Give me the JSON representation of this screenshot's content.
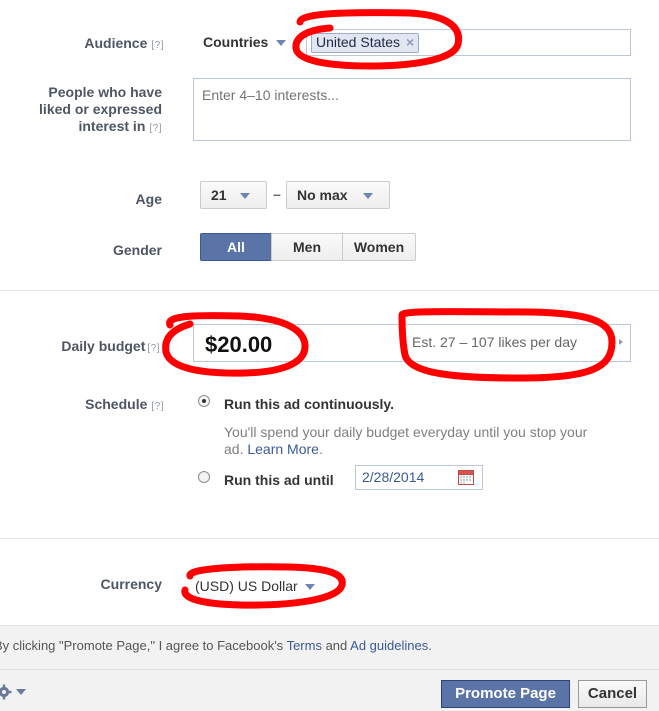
{
  "targeting": {
    "audience_label": "Audience",
    "help": "[?]",
    "location_type": "Countries",
    "country_token": "United States",
    "token_remove": "×",
    "interests_label_lines": [
      "People who have",
      "liked or expressed",
      "interest in"
    ],
    "interests_placeholder": "Enter 4–10 interests...",
    "age_label": "Age",
    "age_min": "21",
    "age_dash": "–",
    "age_max": "No max",
    "gender_label": "Gender",
    "gender_options": [
      "All",
      "Men",
      "Women"
    ],
    "gender_selected": "All"
  },
  "budget": {
    "daily_label": "Daily budget",
    "help": "[?]",
    "amount": "$20.00",
    "estimate": "Est. 27 – 107 likes per day",
    "schedule_label": "Schedule",
    "option_continuous": "Run this ad continuously.",
    "continuous_note_line1": "You'll spend your daily budget everyday until you stop your",
    "continuous_note_line2": "ad.",
    "learn_more": "Learn More",
    "learn_more_tail": ".",
    "option_until": "Run this ad until",
    "end_date": "2/28/2014",
    "schedule_selected": "continuous"
  },
  "currency": {
    "label": "Currency",
    "value": "(USD) US Dollar"
  },
  "terms": {
    "prefix": "By clicking \"Promote Page,\" I agree to Facebook's ",
    "terms_link": "Terms",
    "and": " and ",
    "guidelines_link": "Ad guidelines",
    "suffix": "."
  },
  "footer": {
    "promote_button": "Promote Page",
    "cancel_button": "Cancel",
    "settings_icon": "gear-icon"
  },
  "colors": {
    "annotation_red": "#ff0000",
    "primary_blue": "#5b74a8",
    "link_blue": "#3b5998",
    "label_gray": "#4e5665"
  }
}
